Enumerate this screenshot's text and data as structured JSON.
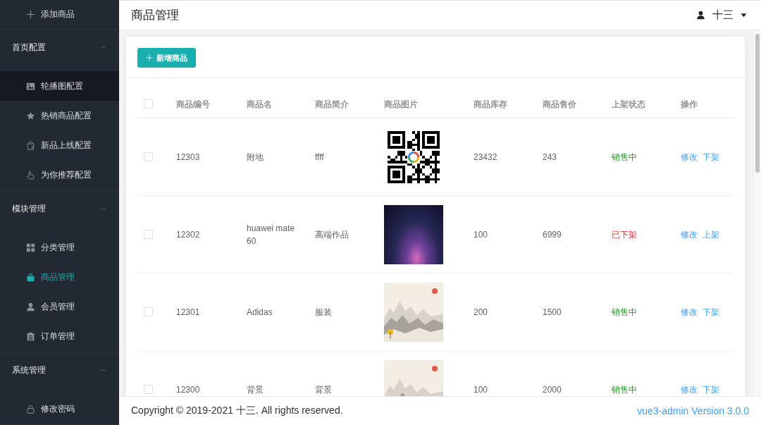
{
  "sidebar": {
    "top_item": {
      "label": "添加商品"
    },
    "groups": [
      {
        "title": "首页配置",
        "expanded": true,
        "items": [
          {
            "label": "轮播图配置",
            "selected": false,
            "hovered": true
          },
          {
            "label": "热销商品配置",
            "selected": false,
            "hovered": false
          },
          {
            "label": "新品上线配置",
            "selected": false,
            "hovered": false
          },
          {
            "label": "为你推荐配置",
            "selected": false,
            "hovered": false
          }
        ]
      },
      {
        "title": "模块管理",
        "expanded": true,
        "items": [
          {
            "label": "分类管理",
            "selected": false,
            "hovered": false
          },
          {
            "label": "商品管理",
            "selected": true,
            "hovered": false
          },
          {
            "label": "会员管理",
            "selected": false,
            "hovered": false
          },
          {
            "label": "订单管理",
            "selected": false,
            "hovered": false
          }
        ]
      },
      {
        "title": "系统管理",
        "expanded": true,
        "items": [
          {
            "label": "修改密码",
            "selected": false,
            "hovered": false
          }
        ]
      }
    ]
  },
  "header": {
    "title": "商品管理",
    "user": "十三"
  },
  "toolbar": {
    "add_button": "新增商品"
  },
  "table": {
    "select_all": {
      "checked": false
    },
    "columns": [
      "商品编号",
      "商品名",
      "商品简介",
      "商品图片",
      "商品库存",
      "商品售价",
      "上架状态",
      "操作"
    ],
    "rows": [
      {
        "checked": false,
        "number": "12303",
        "name": "附地",
        "description": "ffff",
        "image": {
          "kind": "qr-code"
        },
        "stock": "23432",
        "price": "243",
        "status": {
          "label": "销售中",
          "on_sale": true
        },
        "actions": [
          "修改",
          "下架"
        ]
      },
      {
        "checked": false,
        "number": "12302",
        "name": "huawei mate 60",
        "description": "高端作品",
        "image": {
          "kind": "photo"
        },
        "stock": "100",
        "price": "6999",
        "status": {
          "label": "已下架",
          "on_sale": false
        },
        "actions": [
          "修改",
          "上架"
        ]
      },
      {
        "checked": false,
        "number": "12301",
        "name": "Adidas",
        "description": "服装",
        "image": {
          "kind": "landscape"
        },
        "stock": "200",
        "price": "1500",
        "status": {
          "label": "销售中",
          "on_sale": true
        },
        "actions": [
          "修改",
          "下架"
        ]
      },
      {
        "checked": false,
        "number": "12300",
        "name": "背景",
        "description": "背景",
        "image": {
          "kind": "landscape"
        },
        "stock": "100",
        "price": "2000",
        "status": {
          "label": "销售中",
          "on_sale": true
        },
        "actions": [
          "修改",
          "下架"
        ]
      }
    ]
  },
  "footer": {
    "copyright": "Copyright © 2019-2021 十三. All rights reserved.",
    "version": "vue3-admin Version 3.0.0"
  }
}
